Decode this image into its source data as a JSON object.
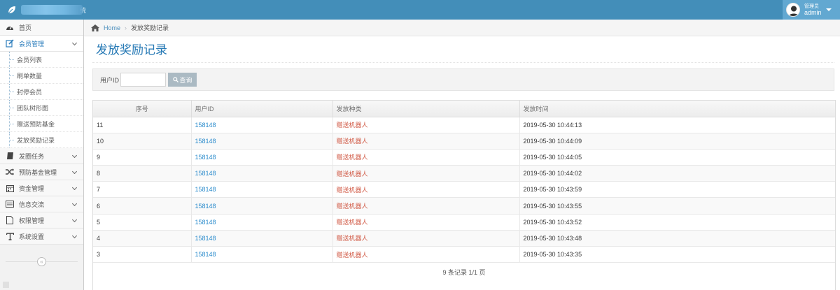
{
  "navbar": {
    "brand_tail": "统",
    "user_role": "管理员",
    "user_name": "admin"
  },
  "sidebar": {
    "items": [
      {
        "label": "首页",
        "icon": "dashboard-icon",
        "open": false,
        "has_children": false
      },
      {
        "label": "会员管理",
        "icon": "edit-icon",
        "open": true,
        "has_children": true,
        "children": [
          "会员列表",
          "刷单数量",
          "封停会员",
          "团队树形图",
          "赠送预防基金",
          "发放奖励记录"
        ]
      },
      {
        "label": "发圈任务",
        "icon": "book-icon",
        "open": false,
        "has_children": true
      },
      {
        "label": "预防基金管理",
        "icon": "shuffle-icon",
        "open": false,
        "has_children": true
      },
      {
        "label": "资金管理",
        "icon": "calendar-icon",
        "open": false,
        "has_children": true
      },
      {
        "label": "信息交流",
        "icon": "list-alt-icon",
        "open": false,
        "has_children": true
      },
      {
        "label": "权限管理",
        "icon": "file-icon",
        "open": false,
        "has_children": true
      },
      {
        "label": "系统设置",
        "icon": "text-icon",
        "open": false,
        "has_children": true
      }
    ],
    "collapse_glyph": "«"
  },
  "breadcrumb": {
    "home": "Home",
    "current": "发放奖励记录"
  },
  "page": {
    "title": "发放奖励记录"
  },
  "search": {
    "label": "用户ID",
    "value": "",
    "button": "查询"
  },
  "table": {
    "columns": [
      "序号",
      "用户ID",
      "发放种类",
      "发放时间"
    ],
    "rows": [
      [
        "11",
        "158148",
        "赠送机器人",
        "2019-05-30 10:44:13"
      ],
      [
        "10",
        "158148",
        "赠送机器人",
        "2019-05-30 10:44:09"
      ],
      [
        "9",
        "158148",
        "赠送机器人",
        "2019-05-30 10:44:05"
      ],
      [
        "8",
        "158148",
        "赠送机器人",
        "2019-05-30 10:44:02"
      ],
      [
        "7",
        "158148",
        "赠送机器人",
        "2019-05-30 10:43:59"
      ],
      [
        "6",
        "158148",
        "赠送机器人",
        "2019-05-30 10:43:55"
      ],
      [
        "5",
        "158148",
        "赠送机器人",
        "2019-05-30 10:43:52"
      ],
      [
        "4",
        "158148",
        "赠送机器人",
        "2019-05-30 10:43:48"
      ],
      [
        "3",
        "158148",
        "赠送机器人",
        "2019-05-30 10:43:35"
      ]
    ],
    "pager": "9 条记录 1/1 页"
  },
  "colors": {
    "navbar": "#438eb9",
    "link": "#2a8bcc",
    "danger_text": "#d15b47",
    "title": "#2679b5"
  }
}
